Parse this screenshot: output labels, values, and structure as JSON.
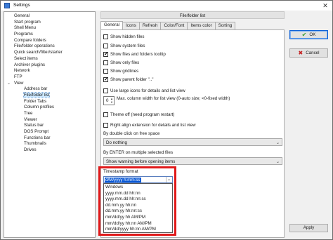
{
  "window": {
    "title": "Settings"
  },
  "tree": {
    "items": [
      {
        "label": "General",
        "level": 0
      },
      {
        "label": "Start program",
        "level": 0
      },
      {
        "label": "Shell Menu",
        "level": 0
      },
      {
        "label": "Programs",
        "level": 0
      },
      {
        "label": "Compare folders",
        "level": 0
      },
      {
        "label": "File/folder operations",
        "level": 0
      },
      {
        "label": "Quick search/filter/starter",
        "level": 0
      },
      {
        "label": "Select items",
        "level": 0
      },
      {
        "label": "Archiver plugins",
        "level": 0
      },
      {
        "label": "Network",
        "level": 0
      },
      {
        "label": "FTP",
        "level": 0
      },
      {
        "label": "View",
        "level": 0,
        "expanded": true
      },
      {
        "label": "Address bar",
        "level": 1
      },
      {
        "label": "File/folder list",
        "level": 1,
        "selected": true
      },
      {
        "label": "Folder Tabs",
        "level": 1
      },
      {
        "label": "Column profiles",
        "level": 1
      },
      {
        "label": "Tree",
        "level": 1
      },
      {
        "label": "Viewer",
        "level": 1
      },
      {
        "label": "Status bar",
        "level": 1
      },
      {
        "label": "DOS Prompt",
        "level": 1
      },
      {
        "label": "Functions bar",
        "level": 1
      },
      {
        "label": "Thumbnails",
        "level": 1
      },
      {
        "label": "Drives",
        "level": 1
      }
    ]
  },
  "panel": {
    "title": "File/folder list",
    "tabs": [
      "General",
      "Icons",
      "Refresh",
      "Color/Font",
      "Items color",
      "Sorting"
    ],
    "active_tab": "General"
  },
  "options": {
    "show_hidden": {
      "label": "Show hidden files",
      "checked": false
    },
    "show_system": {
      "label": "Show system files",
      "checked": false
    },
    "show_tooltip": {
      "label": "Show files and folders tooltip",
      "checked": true
    },
    "show_only_files": {
      "label": "Show only files",
      "checked": false
    },
    "show_gridlines": {
      "label": "Show gridlines",
      "checked": false
    },
    "show_parent": {
      "label": "Show parent folder \"..\"",
      "checked": true
    },
    "large_icons": {
      "label": "Use large icons for details and list view",
      "checked": false
    },
    "theme_off": {
      "label": "Theme off (need program restart)",
      "checked": false
    },
    "right_align": {
      "label": "Right align extension for details and list view",
      "checked": false
    }
  },
  "max_width": {
    "value": "0",
    "label": "Max. column width for list view (0-auto size; <0-fixed width)"
  },
  "double_click": {
    "label": "By double click on free space",
    "value": "Do nothing"
  },
  "enter_multiple": {
    "label": "By ENTER on multiple selected files",
    "value": "Show warning before opening items"
  },
  "timestamp": {
    "label": "Timestamp format",
    "value": "d/M/yyyy h:mm:ss",
    "options": [
      "Windows",
      "yyyy.mm.dd hh:nn",
      "yyyy.mm.dd hh:nn:ss",
      "dd.mm.yy hh:nn",
      "dd.mm.yy hh:nn:ss",
      "mm/dd/yy hh AM/PM",
      "mm/dd/yy hh:nn AM/PM",
      "mm/dd/yyyy hh:nn AM/PM"
    ]
  },
  "buttons": {
    "ok": "OK",
    "cancel": "Cancel",
    "apply": "Apply"
  },
  "colors": {
    "selection": "#cce8ff",
    "highlight_border": "#e0191a",
    "combo_selected": "#0a59d6"
  }
}
